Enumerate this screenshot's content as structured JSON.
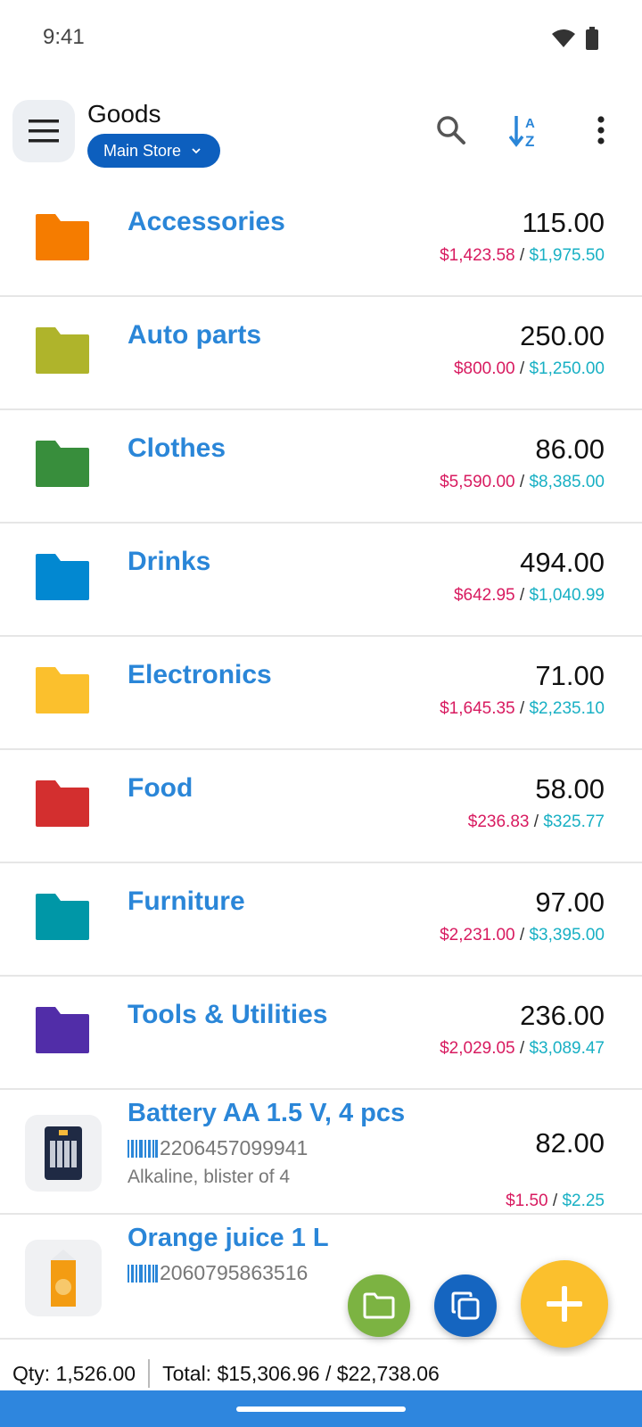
{
  "status": {
    "time": "9:41"
  },
  "header": {
    "title": "Goods",
    "store": "Main Store"
  },
  "categories": [
    {
      "name": "Accessories",
      "qty": "115.00",
      "cost": "$1,423.58",
      "retail": "$1,975.50",
      "color": "#f57c00"
    },
    {
      "name": "Auto parts",
      "qty": "250.00",
      "cost": "$800.00",
      "retail": "$1,250.00",
      "color": "#afb42b"
    },
    {
      "name": "Clothes",
      "qty": "86.00",
      "cost": "$5,590.00",
      "retail": "$8,385.00",
      "color": "#388e3c"
    },
    {
      "name": "Drinks",
      "qty": "494.00",
      "cost": "$642.95",
      "retail": "$1,040.99",
      "color": "#0288d1"
    },
    {
      "name": "Electronics",
      "qty": "71.00",
      "cost": "$1,645.35",
      "retail": "$2,235.10",
      "color": "#fbc02d"
    },
    {
      "name": "Food",
      "qty": "58.00",
      "cost": "$236.83",
      "retail": "$325.77",
      "color": "#d32f2f"
    },
    {
      "name": "Furniture",
      "qty": "97.00",
      "cost": "$2,231.00",
      "retail": "$3,395.00",
      "color": "#0097a7"
    },
    {
      "name": "Tools & Utilities",
      "qty": "236.00",
      "cost": "$2,029.05",
      "retail": "$3,089.47",
      "color": "#512da8"
    }
  ],
  "items": [
    {
      "name": "Battery AA 1.5 V, 4 pcs",
      "barcode": "2206457099941",
      "desc": "Alkaline, blister of 4",
      "qty": "82.00",
      "cost": "$1.50",
      "retail": "$2.25"
    },
    {
      "name": "Orange juice 1 L",
      "barcode": "2060795863516",
      "desc": "",
      "qty": "",
      "cost": "",
      "retail": ""
    }
  ],
  "summary": {
    "qty": "Qty: 1,526.00",
    "total": "Total: $15,306.96 / $22,738.06"
  },
  "colors": {
    "accent": "#2a86d8",
    "cost": "#d81b60",
    "retail": "#18b0c4",
    "nav": "#2e86de"
  }
}
